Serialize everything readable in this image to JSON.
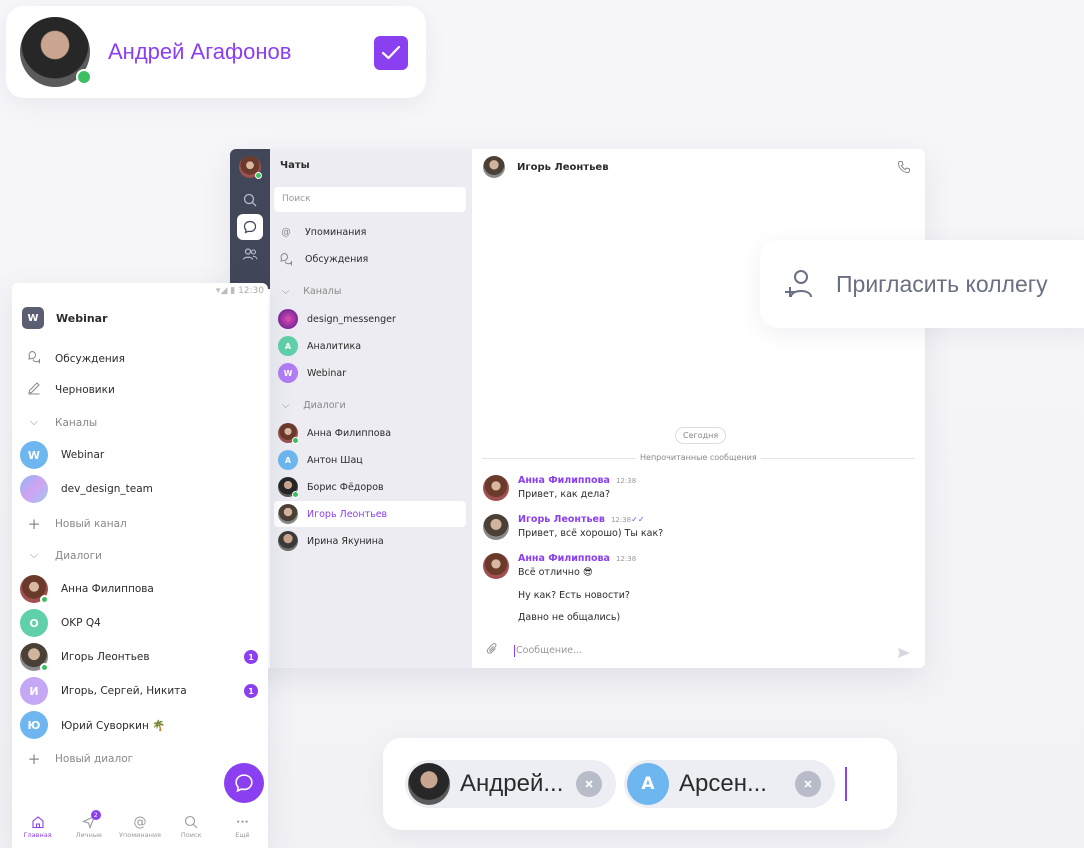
{
  "user_card": {
    "name": "Андрей Агафонов",
    "checked": true
  },
  "desktop": {
    "rail_icons": [
      "avatar",
      "search-icon",
      "chat-icon",
      "contacts-icon"
    ],
    "chatlist": {
      "title": "Чаты",
      "search_placeholder": "Поиск",
      "mentions": "Упоминания",
      "discussions": "Обсуждения",
      "channels_header": "Каналы",
      "channels": [
        {
          "name": "design_messenger",
          "letter": ""
        },
        {
          "name": "Аналитика",
          "letter": "А"
        },
        {
          "name": "Webinar",
          "letter": "W"
        }
      ],
      "dialogs_header": "Диалоги",
      "dialogs": [
        {
          "name": "Анна Филиппова",
          "letter": ""
        },
        {
          "name": "Антон Шац",
          "letter": "А"
        },
        {
          "name": "Борис Фёдоров",
          "letter": ""
        },
        {
          "name": "Игорь Леонтьев",
          "letter": ""
        },
        {
          "name": "Ирина Якунина",
          "letter": ""
        }
      ]
    },
    "chat": {
      "contact_name": "Игорь Леонтьев",
      "date_chip": "Сегодня",
      "unread_label": "Непрочитанные сообщения",
      "messages": [
        {
          "author": "Анна Филиппова",
          "time": "12:38",
          "text": "Привет, как дела?"
        },
        {
          "author": "Игорь Леонтьев",
          "time": "12:38",
          "text": "Привет, всё хорошо) Ты как?"
        },
        {
          "author": "Анна Филиппова",
          "time": "12:38",
          "text": "Всё отлично 😎"
        }
      ],
      "followups": [
        "Ну как? Есть новости?",
        "Давно не общались)"
      ],
      "composer_placeholder": "Сообщение..."
    }
  },
  "invite": {
    "label": "Пригласить коллегу"
  },
  "mobile": {
    "status_time": "12:30",
    "workspace_letter": "W",
    "workspace_name": "Webinar",
    "discussions": "Обсуждения",
    "drafts": "Черновики",
    "channels_header": "Каналы",
    "channels": [
      {
        "name": "Webinar",
        "letter": "W"
      },
      {
        "name": "dev_design_team",
        "letter": ""
      }
    ],
    "new_channel": "Новый канал",
    "dialogs_header": "Диалоги",
    "dialogs": [
      {
        "name": "Анна Филиппова",
        "letter": "",
        "badge": ""
      },
      {
        "name": "OKP Q4",
        "letter": "O",
        "badge": ""
      },
      {
        "name": "Игорь Леонтьев",
        "letter": "",
        "badge": "1"
      },
      {
        "name": "Игорь, Сергей, Никита",
        "letter": "И",
        "badge": "1"
      },
      {
        "name": "Юрий Суворкин 🌴",
        "letter": "Ю",
        "badge": ""
      }
    ],
    "new_dialog": "Новый диалог",
    "tabs": [
      {
        "label": "Главная",
        "badge": ""
      },
      {
        "label": "Личные",
        "badge": "2"
      },
      {
        "label": "Упоминания",
        "badge": ""
      },
      {
        "label": "Поиск",
        "badge": ""
      },
      {
        "label": "Ещё",
        "badge": ""
      }
    ]
  },
  "tags": [
    {
      "name": "Андрей...",
      "letter": ""
    },
    {
      "name": "Арсен...",
      "letter": "А"
    }
  ]
}
